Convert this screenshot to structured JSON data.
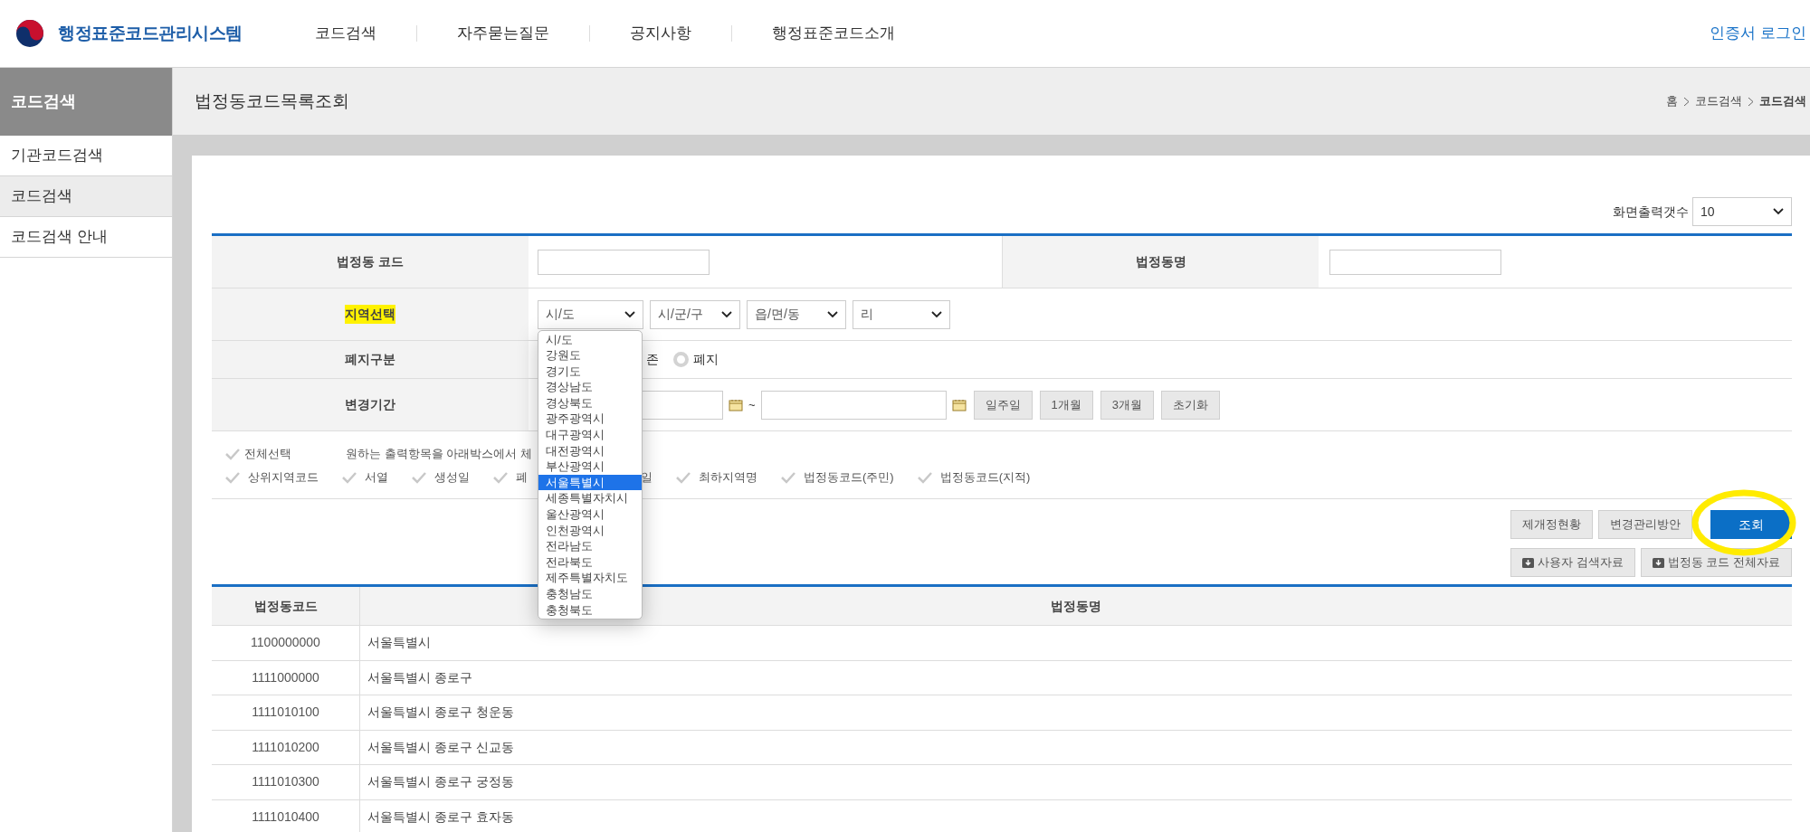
{
  "header": {
    "logo": "행정표준코드관리시스템",
    "nav": [
      "코드검색",
      "자주묻는질문",
      "공지사항",
      "행정표준코드소개"
    ],
    "login": "인증서 로그인"
  },
  "sidebar": {
    "title": "코드검색",
    "items": [
      {
        "label": "기관코드검색",
        "selected": false
      },
      {
        "label": "코드검색",
        "selected": true
      },
      {
        "label": "코드검색 안내",
        "selected": false
      }
    ]
  },
  "page": {
    "title": "법정동코드목록조회",
    "breadcrumb": [
      "홈",
      "코드검색",
      "코드검색"
    ]
  },
  "page_size": {
    "label": "화면출력갯수",
    "value": "10"
  },
  "form": {
    "code_label": "법정동 코드",
    "name_label": "법정동명",
    "region_label": "지역선택",
    "region_highlighted": true,
    "selects": [
      "시/도",
      "시/군/구",
      "읍/면/동",
      "리"
    ],
    "options": [
      {
        "label": "시/도",
        "selected": false
      },
      {
        "label": "강원도",
        "selected": false
      },
      {
        "label": "경기도",
        "selected": false
      },
      {
        "label": "경상남도",
        "selected": false
      },
      {
        "label": "경상북도",
        "selected": false
      },
      {
        "label": "광주광역시",
        "selected": false
      },
      {
        "label": "대구광역시",
        "selected": false
      },
      {
        "label": "대전광역시",
        "selected": false
      },
      {
        "label": "부산광역시",
        "selected": false
      },
      {
        "label": "서울특별시",
        "selected": true
      },
      {
        "label": "세종특별자치시",
        "selected": false
      },
      {
        "label": "울산광역시",
        "selected": false
      },
      {
        "label": "인천광역시",
        "selected": false
      },
      {
        "label": "전라남도",
        "selected": false
      },
      {
        "label": "전라북도",
        "selected": false
      },
      {
        "label": "제주특별자치도",
        "selected": false
      },
      {
        "label": "충청남도",
        "selected": false
      },
      {
        "label": "충청북도",
        "selected": false
      }
    ],
    "abolish_label": "폐지구분",
    "abolish_fragment": "존",
    "abolish_radio": {
      "label": "폐지",
      "selected": false
    },
    "period_label": "변경기간",
    "period_sep": "~",
    "period_buttons": [
      "일주일",
      "1개월",
      "3개월",
      "초기화"
    ]
  },
  "output": {
    "select_all": {
      "label": "전체선택",
      "checked": false
    },
    "hint": "원하는 출력항목을 아래박스에서 체",
    "items": [
      {
        "kind": "checkbox",
        "label": "상위지역코드",
        "checked": false
      },
      {
        "kind": "checkbox",
        "label": "서열",
        "checked": false
      },
      {
        "kind": "checkbox",
        "label": "생성일",
        "checked": false
      },
      {
        "kind": "checkbox",
        "label": "폐",
        "checked": false
      },
      {
        "kind": "fragment",
        "label": "일"
      },
      {
        "kind": "checkbox",
        "label": "최하지역명",
        "checked": false
      },
      {
        "kind": "checkbox",
        "label": "법정동코드(주민)",
        "checked": false
      },
      {
        "kind": "checkbox",
        "label": "법정동코드(지적)",
        "checked": false
      }
    ]
  },
  "actions": {
    "buttons": [
      "제개정현황",
      "변경관리방안"
    ],
    "search": {
      "label": "조회",
      "circled": true
    },
    "downloads": [
      "사용자 검색자료",
      "법정동 코드 전체자료"
    ]
  },
  "results": {
    "columns": [
      "법정동코드",
      "법정동명"
    ],
    "rows": [
      [
        "1100000000",
        "서울특별시"
      ],
      [
        "1111000000",
        "서울특별시 종로구"
      ],
      [
        "1111010100",
        "서울특별시 종로구 청운동"
      ],
      [
        "1111010200",
        "서울특별시 종로구 신교동"
      ],
      [
        "1111010300",
        "서울특별시 종로구 궁정동"
      ],
      [
        "1111010400",
        "서울특별시 종로구 효자동"
      ]
    ]
  }
}
